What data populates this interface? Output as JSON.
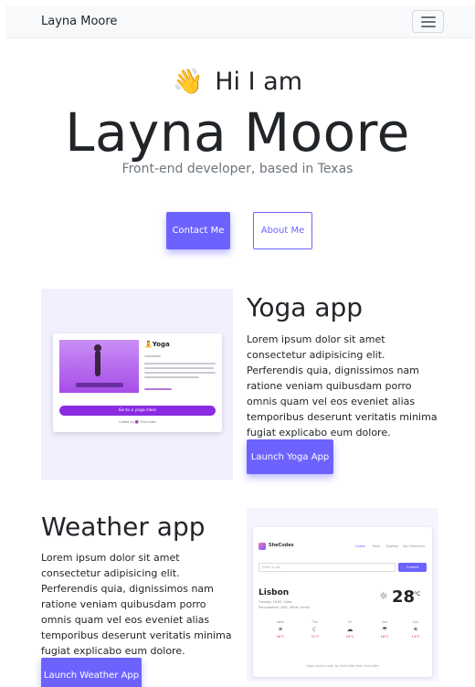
{
  "navbar": {
    "brand": "Layna Moore",
    "toggler_icon": "hamburger-icon"
  },
  "hero": {
    "wave_emoji": "👋",
    "greeting": "Hi I am",
    "name": "Layna Moore",
    "subtitle": "Front-end developer, based in Texas",
    "contact_label": "Contact Me",
    "about_label": "About Me"
  },
  "projects": [
    {
      "title": "Yoga app",
      "description": "Lorem ipsum dolor sit amet consectetur adipisicing elit. Perferendis quia, dignissimos nam ratione veniam quibusdam porro omnis quam vel eos eveniet alias temporibus deserunt veritatis minima fugiat explicabo eum dolore.",
      "button_label": "Launch Yoga App",
      "preview": {
        "title": "🧘Yoga",
        "button": "Go to a yoga class",
        "credit": "Coded by 🟣 SheCodes"
      }
    },
    {
      "title": "Weather app",
      "description": "Lorem ipsum dolor sit amet consectetur adipisicing elit. Perferendis quia, dignissimos nam ratione veniam quibusdam porro omnis quam vel eos eveniet alias temporibus deserunt veritatis minima fugiat explicabo eum dolore.",
      "button_label": "Launch Weather App",
      "preview": {
        "brand": "SheCodes",
        "tabs": [
          "Lisbon",
          "Paris",
          "Sydney",
          "San Francisco"
        ],
        "search_placeholder": "Enter a city",
        "search_button": "Current",
        "city": "Lisbon",
        "date_line": "Tuesday 16:00, Clear",
        "detail_line": "Precipitation: 48%, Wind: 3km/h",
        "temperature": "28",
        "unit": "°C",
        "forecast": [
          {
            "day": "Wed",
            "icon": "☀",
            "temp": "26°C"
          },
          {
            "day": "Thu",
            "icon": "☾",
            "temp": "21°C"
          },
          {
            "day": "Fri",
            "icon": "☁",
            "temp": "16°C"
          },
          {
            "day": "Sat",
            "icon": "☂",
            "temp": "16°C"
          },
          {
            "day": "Sun",
            "icon": "☀",
            "temp": "14°C"
          }
        ],
        "footer": "Open source code, by SheCodes from SheCodes"
      }
    }
  ]
}
